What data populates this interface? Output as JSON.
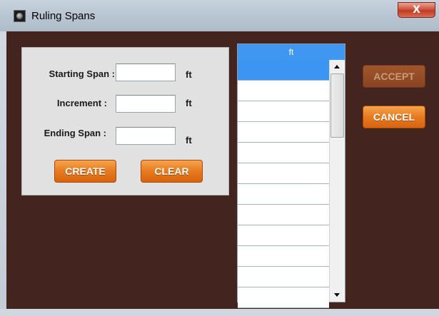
{
  "window": {
    "title": "Ruling Spans",
    "close_label": "X"
  },
  "form": {
    "starting_span": {
      "label": "Starting Span :",
      "value": "",
      "unit": "ft"
    },
    "increment": {
      "label": "Increment :",
      "value": "",
      "unit": "ft"
    },
    "ending_span": {
      "label": "Ending Span :",
      "value": "",
      "unit": "ft"
    },
    "create_label": "CREATE",
    "clear_label": "CLEAR"
  },
  "list": {
    "header": "ft",
    "rows": [
      "",
      "",
      "",
      "",
      "",
      "",
      "",
      "",
      "",
      "",
      "",
      ""
    ],
    "selected_index": 0
  },
  "actions": {
    "accept_label": "ACCEPT",
    "accept_enabled": false,
    "cancel_label": "CANCEL"
  },
  "colors": {
    "background": "#43241f",
    "accent_orange": "#e57a1f",
    "list_header": "#3f97f2",
    "selection": "#3d95f3"
  }
}
